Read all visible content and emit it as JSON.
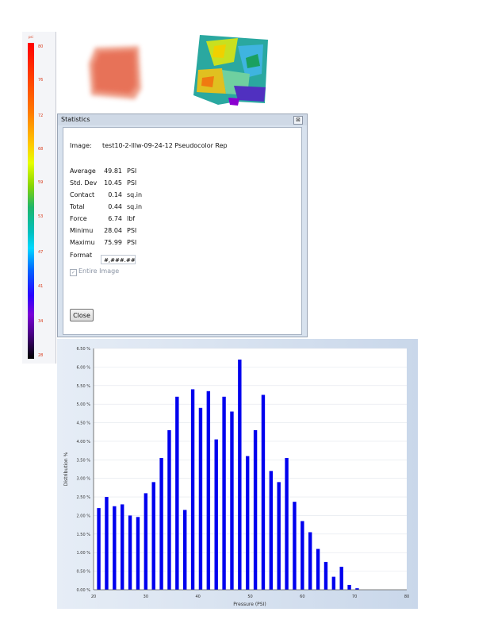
{
  "colorbar": {
    "unit": "psi",
    "ticks": [
      "80",
      "76",
      "72",
      "68",
      "59",
      "53",
      "47",
      "41",
      "34",
      "28"
    ]
  },
  "statistics": {
    "title": "Statistics",
    "close_glyph": "⊠",
    "image_label": "Image:",
    "image_name": "test10-2-lllw-09-24-12 Pseudocolor Rep",
    "rows": [
      {
        "label": "Average",
        "value": "49.81",
        "unit": "PSI"
      },
      {
        "label": "Std. Dev",
        "value": "10.45",
        "unit": "PSI"
      },
      {
        "label": "Contact",
        "value": "0.14",
        "unit": "sq.in"
      },
      {
        "label": "Total",
        "value": "0.44",
        "unit": "sq.in"
      },
      {
        "label": "Force",
        "value": "6.74",
        "unit": "lbf"
      },
      {
        "label": "Minimu",
        "value": "28.04",
        "unit": "PSI"
      },
      {
        "label": "Maximu",
        "value": "75.99",
        "unit": "PSI"
      }
    ],
    "format_label": "Format",
    "format_value": "#,###.##",
    "entire_image_label": "Entire Image",
    "entire_image_checked": true,
    "close_button": "Close"
  },
  "chart_data": {
    "type": "bar",
    "xlabel": "Pressure (PSI)",
    "ylabel": "Distribution %",
    "xlim": [
      20,
      80
    ],
    "ylim": [
      0,
      6.5
    ],
    "xticks": [
      "20",
      "30",
      "40",
      "50",
      "60",
      "70",
      "80"
    ],
    "yticks": [
      "0.00 %",
      "0.50 %",
      "1.00 %",
      "1.50 %",
      "2.00 %",
      "2.50 %",
      "3.00 %",
      "3.50 %",
      "4.00 %",
      "4.50 %",
      "5.00 %",
      "5.50 %",
      "6.00 %",
      "6.50 %"
    ],
    "bar_color": "#0000ee",
    "x": [
      21,
      22.5,
      24,
      25.5,
      27,
      28.5,
      30,
      31.5,
      33,
      34.5,
      36,
      37.5,
      39,
      40.5,
      42,
      43.5,
      45,
      46.5,
      48,
      49.5,
      51,
      52.5,
      54,
      55.5,
      57,
      58.5,
      60,
      61.5,
      63,
      64.5,
      66,
      67.5,
      69,
      70.5,
      72,
      73.5,
      75
    ],
    "values": [
      2.2,
      2.5,
      2.25,
      2.3,
      2.0,
      1.96,
      2.6,
      2.9,
      3.55,
      4.3,
      5.2,
      2.15,
      5.4,
      4.9,
      5.35,
      4.05,
      5.2,
      4.8,
      6.2,
      3.6,
      4.3,
      5.25,
      3.2,
      2.9,
      3.55,
      2.37,
      1.85,
      1.55,
      1.1,
      0.75,
      0.35,
      0.62,
      0.13,
      0.04,
      0.0,
      0.0,
      0.0
    ]
  }
}
